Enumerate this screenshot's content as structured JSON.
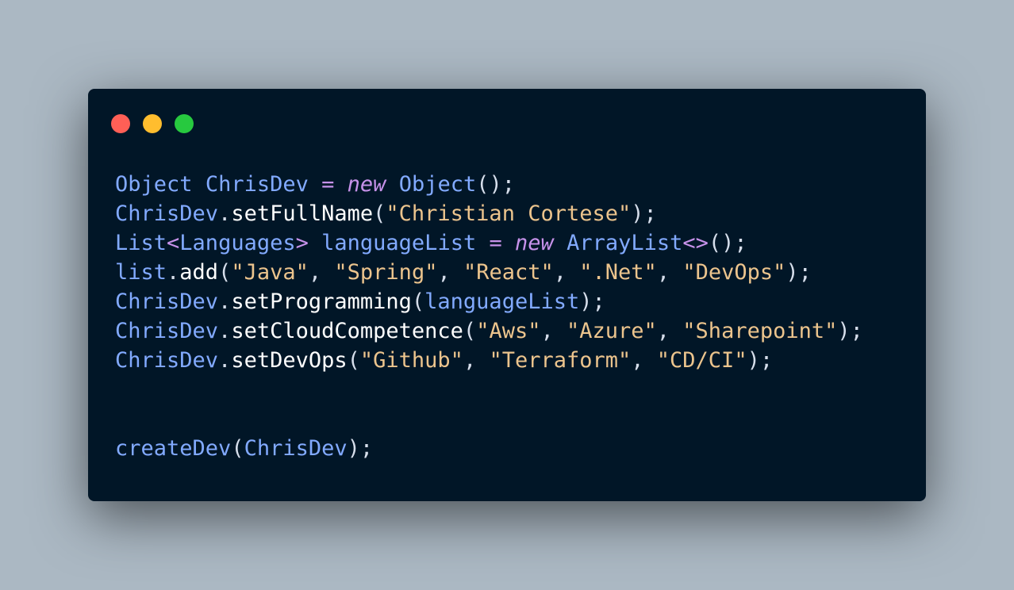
{
  "window": {
    "controls": [
      {
        "name": "close",
        "color": "#ff5f56"
      },
      {
        "name": "minimize",
        "color": "#ffbd2e"
      },
      {
        "name": "maximize",
        "color": "#27c93f"
      }
    ]
  },
  "theme": {
    "background": "#abb8c3",
    "editor_background": "#011627",
    "identifier": "#82aaff",
    "method": "#ffffff",
    "string": "#ecc48d",
    "keyword": "#c792ea",
    "punctuation": "#d6deeb"
  },
  "code": {
    "lines": [
      [
        {
          "t": "Object",
          "k": "id"
        },
        {
          "t": " ",
          "k": "plain"
        },
        {
          "t": "ChrisDev",
          "k": "id"
        },
        {
          "t": " ",
          "k": "plain"
        },
        {
          "t": "=",
          "k": "op"
        },
        {
          "t": " ",
          "k": "plain"
        },
        {
          "t": "new",
          "k": "kw"
        },
        {
          "t": " ",
          "k": "plain"
        },
        {
          "t": "Object",
          "k": "id"
        },
        {
          "t": "();",
          "k": "punct"
        }
      ],
      [
        {
          "t": "ChrisDev",
          "k": "id"
        },
        {
          "t": ".",
          "k": "punct"
        },
        {
          "t": "setFullName",
          "k": "method"
        },
        {
          "t": "(",
          "k": "punct"
        },
        {
          "t": "\"Christian Cortese\"",
          "k": "str"
        },
        {
          "t": ");",
          "k": "punct"
        }
      ],
      [
        {
          "t": "List",
          "k": "id"
        },
        {
          "t": "<",
          "k": "op"
        },
        {
          "t": "Languages",
          "k": "id"
        },
        {
          "t": ">",
          "k": "op"
        },
        {
          "t": " ",
          "k": "plain"
        },
        {
          "t": "languageList",
          "k": "id"
        },
        {
          "t": " ",
          "k": "plain"
        },
        {
          "t": "=",
          "k": "op"
        },
        {
          "t": " ",
          "k": "plain"
        },
        {
          "t": "new",
          "k": "kw"
        },
        {
          "t": " ",
          "k": "plain"
        },
        {
          "t": "ArrayList",
          "k": "id"
        },
        {
          "t": "<>",
          "k": "op"
        },
        {
          "t": "();",
          "k": "punct"
        }
      ],
      [
        {
          "t": "list",
          "k": "id"
        },
        {
          "t": ".",
          "k": "punct"
        },
        {
          "t": "add",
          "k": "method"
        },
        {
          "t": "(",
          "k": "punct"
        },
        {
          "t": "\"Java\"",
          "k": "str"
        },
        {
          "t": ", ",
          "k": "punct"
        },
        {
          "t": "\"Spring\"",
          "k": "str"
        },
        {
          "t": ", ",
          "k": "punct"
        },
        {
          "t": "\"React\"",
          "k": "str"
        },
        {
          "t": ", ",
          "k": "punct"
        },
        {
          "t": "\".Net\"",
          "k": "str"
        },
        {
          "t": ", ",
          "k": "punct"
        },
        {
          "t": "\"DevOps\"",
          "k": "str"
        },
        {
          "t": ");",
          "k": "punct"
        }
      ],
      [
        {
          "t": "ChrisDev",
          "k": "id"
        },
        {
          "t": ".",
          "k": "punct"
        },
        {
          "t": "setProgramming",
          "k": "method"
        },
        {
          "t": "(",
          "k": "punct"
        },
        {
          "t": "languageList",
          "k": "id"
        },
        {
          "t": ");",
          "k": "punct"
        }
      ],
      [
        {
          "t": "ChrisDev",
          "k": "id"
        },
        {
          "t": ".",
          "k": "punct"
        },
        {
          "t": "setCloudCompetence",
          "k": "method"
        },
        {
          "t": "(",
          "k": "punct"
        },
        {
          "t": "\"Aws\"",
          "k": "str"
        },
        {
          "t": ", ",
          "k": "punct"
        },
        {
          "t": "\"Azure\"",
          "k": "str"
        },
        {
          "t": ", ",
          "k": "punct"
        },
        {
          "t": "\"Sharepoint\"",
          "k": "str"
        },
        {
          "t": ");",
          "k": "punct"
        }
      ],
      [
        {
          "t": "ChrisDev",
          "k": "id"
        },
        {
          "t": ".",
          "k": "punct"
        },
        {
          "t": "setDevOps",
          "k": "method"
        },
        {
          "t": "(",
          "k": "punct"
        },
        {
          "t": "\"Github\"",
          "k": "str"
        },
        {
          "t": ", ",
          "k": "punct"
        },
        {
          "t": "\"Terraform\"",
          "k": "str"
        },
        {
          "t": ", ",
          "k": "punct"
        },
        {
          "t": "\"CD/CI\"",
          "k": "str"
        },
        {
          "t": ");",
          "k": "punct"
        }
      ],
      [],
      [],
      [
        {
          "t": "createDev",
          "k": "id"
        },
        {
          "t": "(",
          "k": "punct"
        },
        {
          "t": "ChrisDev",
          "k": "id"
        },
        {
          "t": ");",
          "k": "punct"
        }
      ]
    ]
  }
}
